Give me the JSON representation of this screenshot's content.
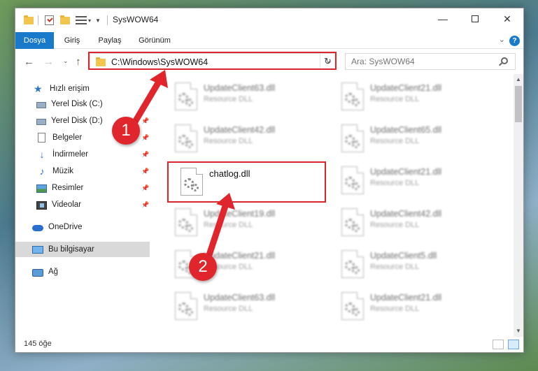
{
  "window": {
    "title": "SysWOW64"
  },
  "ribbon": {
    "tabs": [
      {
        "label": "Dosya",
        "active": true
      },
      {
        "label": "Giriş",
        "active": false
      },
      {
        "label": "Paylaş",
        "active": false
      },
      {
        "label": "Görünüm",
        "active": false
      }
    ],
    "help_label": "?"
  },
  "navbar": {
    "address": "C:\\Windows\\SysWOW64",
    "search_placeholder": "Ara: SysWOW64"
  },
  "sidebar": {
    "items": [
      {
        "label": "Hızlı erişim",
        "icon": "star-icon",
        "pinned": false
      },
      {
        "label": "Yerel Disk (C:)",
        "icon": "disk-icon",
        "pinned": true
      },
      {
        "label": "Yerel Disk (D:)",
        "icon": "disk-icon",
        "pinned": true
      },
      {
        "label": "Belgeler",
        "icon": "document-icon",
        "pinned": true
      },
      {
        "label": "İndirmeler",
        "icon": "download-icon",
        "pinned": true
      },
      {
        "label": "Müzik",
        "icon": "music-icon",
        "pinned": true
      },
      {
        "label": "Resimler",
        "icon": "pictures-icon",
        "pinned": true
      },
      {
        "label": "Videolar",
        "icon": "video-icon",
        "pinned": true
      },
      {
        "label": "OneDrive",
        "icon": "cloud-icon",
        "pinned": false
      },
      {
        "label": "Bu bilgisayar",
        "icon": "computer-icon",
        "pinned": false,
        "selected": true
      },
      {
        "label": "Ağ",
        "icon": "network-icon",
        "pinned": false
      }
    ]
  },
  "files": {
    "left": [
      {
        "name": "UpdateClient63.dll",
        "type": "Resource DLL"
      },
      {
        "name": "UpdateClient42.dll",
        "type": "Resource DLL"
      },
      {
        "name": "chatlog.dll",
        "type": ""
      },
      {
        "name": "UpdateClient19.dll",
        "type": "Resource DLL"
      },
      {
        "name": "UpdateClient21.dll",
        "type": "Resource DLL"
      },
      {
        "name": "UpdateClient63.dll",
        "type": "Resource DLL"
      }
    ],
    "right": [
      {
        "name": "UpdateClient21.dll",
        "type": "Resource DLL"
      },
      {
        "name": "UpdateClient65.dll",
        "type": "Resource DLL"
      },
      {
        "name": "UpdateClient21.dll",
        "type": "Resource DLL"
      },
      {
        "name": "UpdateClient42.dll",
        "type": "Resource DLL"
      },
      {
        "name": "UpdateClient5.dll",
        "type": "Resource DLL"
      },
      {
        "name": "UpdateClient21.dll",
        "type": "Resource DLL"
      }
    ]
  },
  "status": {
    "item_count": "145 öğe"
  },
  "annotations": {
    "step1": "1",
    "step2": "2",
    "color": "#e0262c"
  },
  "colors": {
    "accent": "#1979ca",
    "highlight_border": "#d9262c"
  }
}
